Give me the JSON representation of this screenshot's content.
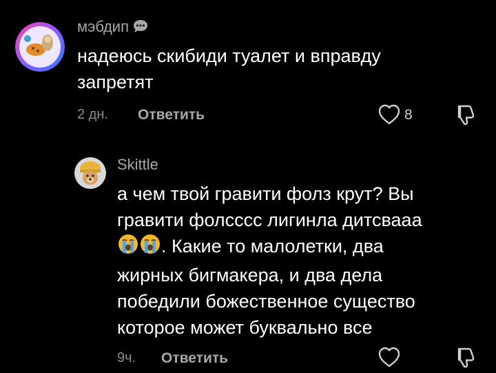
{
  "comments": [
    {
      "username": "мэбдип",
      "badge_icon": "speech-bubble-icon",
      "text_lines": [
        "надеюсь скибиди туалет и вправду",
        "запретят"
      ],
      "age": "2 дн.",
      "reply_label": "Ответить",
      "likes": "8"
    },
    {
      "username": "Skittle",
      "text_lines": [
        "а чем твой гравити фолз крут? Вы",
        "гравити фолсссс лигинла дитсвааа",
        ". Какие то малолетки, два",
        "жирных бигмакера, и два дела",
        "победили божественное существо",
        "которое может буквально все"
      ],
      "emoji": [
        "loudly-crying-face-icon",
        "loudly-crying-face-icon"
      ],
      "age": "9ч.",
      "reply_label": "Ответить"
    }
  ],
  "colors": {
    "background": "#000000",
    "text": "#ffffff",
    "muted": "#a8a8a8",
    "emoji": "#f2b731"
  }
}
